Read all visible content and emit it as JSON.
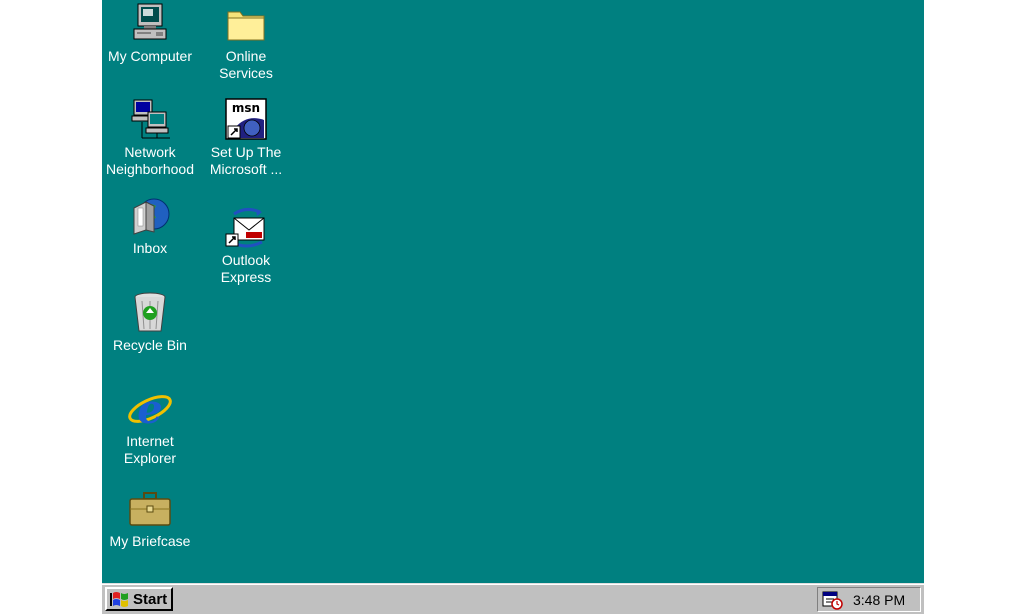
{
  "desktop": {
    "background_color": "#008080",
    "icons": [
      {
        "label": "My Computer",
        "icon": "my-computer-icon"
      },
      {
        "label": "Online\nServices",
        "icon": "folder-icon"
      },
      {
        "label": "Network\nNeighborhood",
        "icon": "network-neighborhood-icon"
      },
      {
        "label": "Set Up The\nMicrosoft ...",
        "icon": "msn-setup-icon"
      },
      {
        "label": "Inbox",
        "icon": "inbox-icon"
      },
      {
        "label": "Outlook\nExpress",
        "icon": "outlook-express-icon"
      },
      {
        "label": "Recycle Bin",
        "icon": "recycle-bin-icon"
      },
      {
        "label": "Internet\nExplorer",
        "icon": "internet-explorer-icon"
      },
      {
        "label": "My Briefcase",
        "icon": "briefcase-icon"
      }
    ]
  },
  "taskbar": {
    "start_label": "Start",
    "clock": "3:48 PM",
    "tray_icon": "scheduler-tray-icon"
  }
}
